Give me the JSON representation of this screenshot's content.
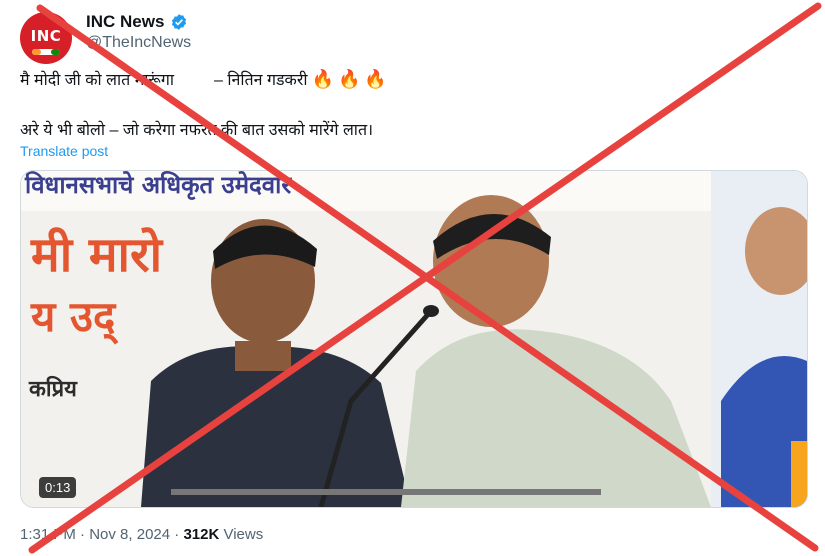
{
  "author": {
    "avatar_text": "INC",
    "display_name": "INC News",
    "handle": "@TheIncNews",
    "verified": true
  },
  "post": {
    "line1_left": "मै मोदी जी को लात मारूंगा",
    "line1_right": "– नितिन गडकरी",
    "fire_emojis": [
      "🔥",
      "🔥",
      "🔥"
    ],
    "line2": "अरे ये भी बोलो – जो करेगा नफरत की बात उसको मारेंगे लात।",
    "translate_link": "Translate post"
  },
  "media": {
    "banner_top": "विधानसभाचे अधिकृत उमेदवार",
    "banner_mid": "मी मारो",
    "banner_low": "य उद्",
    "banner_small": "कप्रिय",
    "duration": "0:13"
  },
  "meta": {
    "time": "1:31 PM",
    "date": "Nov 8, 2024",
    "separator": "·",
    "views_count": "312K",
    "views_label": "Views"
  },
  "colors": {
    "cross_red": "#e8423f",
    "link_blue": "#1d9bf0",
    "brand_red": "#d61f26"
  }
}
